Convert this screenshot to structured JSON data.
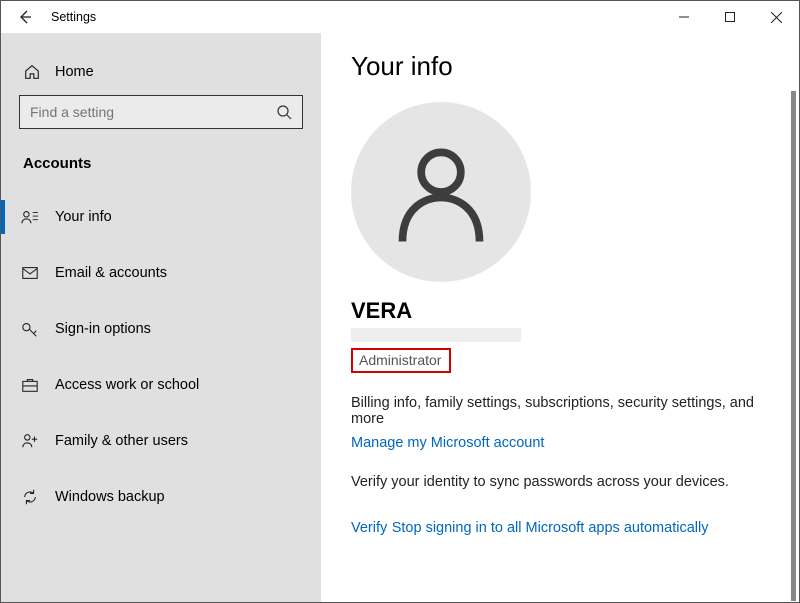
{
  "window": {
    "title": "Settings"
  },
  "sidebar": {
    "home": "Home",
    "search_placeholder": "Find a setting",
    "section": "Accounts",
    "items": [
      {
        "label": "Your info"
      },
      {
        "label": "Email & accounts"
      },
      {
        "label": "Sign-in options"
      },
      {
        "label": "Access work or school"
      },
      {
        "label": "Family & other users"
      },
      {
        "label": "Windows backup"
      }
    ]
  },
  "content": {
    "heading": "Your info",
    "username": "VERA",
    "role": "Administrator",
    "billing_text": "Billing info, family settings, subscriptions, security settings, and more",
    "manage_link": "Manage my Microsoft account",
    "verify_text": "Verify your identity to sync passwords across your devices.",
    "verify_link": "Verify",
    "stop_link": "Stop signing in to all Microsoft apps automatically"
  }
}
